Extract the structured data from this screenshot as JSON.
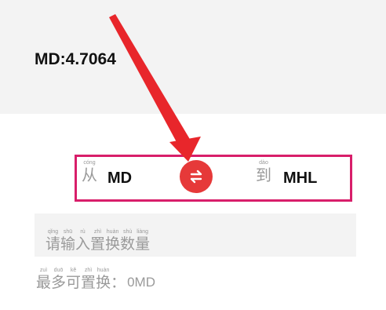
{
  "balance": {
    "text": "MD:4.7064"
  },
  "swap": {
    "from_label": {
      "han": "从",
      "pinyin": "cóng"
    },
    "from_token": "MD",
    "to_label": {
      "han": "到",
      "pinyin": "dào"
    },
    "to_token": "MHL",
    "swap_icon": "swap-arrows-icon"
  },
  "amount_input": {
    "placeholder": [
      {
        "han": "请",
        "pinyin": "qǐng"
      },
      {
        "han": "输",
        "pinyin": "shū"
      },
      {
        "han": "入",
        "pinyin": "rù"
      },
      {
        "han": "置",
        "pinyin": "zhì"
      },
      {
        "han": "换",
        "pinyin": "huàn"
      },
      {
        "han": "数",
        "pinyin": "shù"
      },
      {
        "han": "量",
        "pinyin": "liàng"
      }
    ]
  },
  "max_exchange": {
    "label": [
      {
        "han": "最",
        "pinyin": "zuì"
      },
      {
        "han": "多",
        "pinyin": "duō"
      },
      {
        "han": "可",
        "pinyin": "kě"
      },
      {
        "han": "置",
        "pinyin": "zhì"
      },
      {
        "han": "换",
        "pinyin": "huàn"
      },
      {
        "han": "：",
        "pinyin": ""
      }
    ],
    "value": "0MD"
  },
  "colors": {
    "highlight_border": "#d81e6a",
    "swap_button": "#e63939",
    "annotation_arrow": "#e8262b"
  }
}
